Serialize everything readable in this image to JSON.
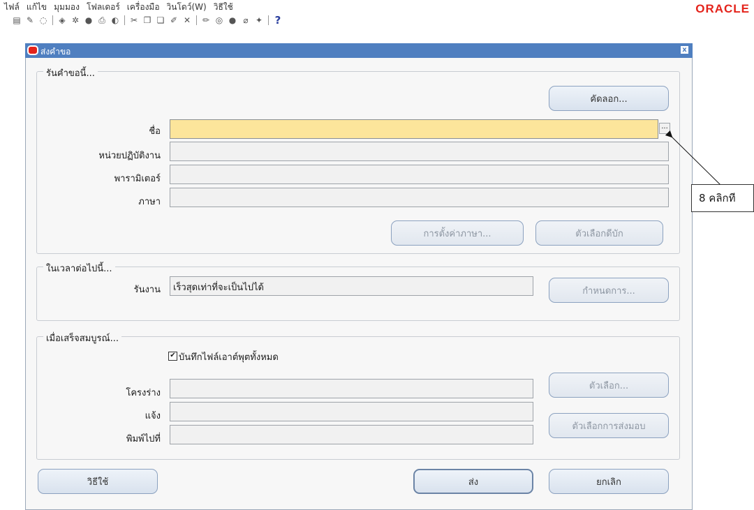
{
  "menubar": [
    "ไฟล์",
    "แก้ไข",
    "มุมมอง",
    "โฟลเดอร์",
    "เครื่องมือ",
    "วินโดว์(W)",
    "วิธีใช้"
  ],
  "brand": "ORACLE",
  "toolbar_help": "?",
  "window": {
    "title": "ส่งคำขอ",
    "close": "x"
  },
  "request_group": {
    "label": "รันคำขอนี้...",
    "copy_button": "คัดลอก...",
    "fields": [
      {
        "label": "ชื่อ",
        "value": ""
      },
      {
        "label": "หน่วยปฏิบัติงาน",
        "value": ""
      },
      {
        "label": "พารามิเตอร์",
        "value": ""
      },
      {
        "label": "ภาษา",
        "value": ""
      }
    ],
    "lov_button": "...",
    "language_settings_button": "การตั้งค่าภาษา...",
    "debug_options_button": "ตัวเลือกดีบัก"
  },
  "schedule_group": {
    "label": "ในเวลาต่อไปนี้...",
    "run_label": "รันงาน",
    "run_value": "เร็วสุดเท่าที่จะเป็นไปได้",
    "schedule_button": "กำหนดการ..."
  },
  "completion_group": {
    "label": "เมื่อเสร็จสมบูรณ์...",
    "save_output_checked": true,
    "save_output_label": "บันทึกไฟล์เอาต์พุตทั้งหมด",
    "layout_label": "โครงร่าง",
    "notify_label": "แจ้ง",
    "print_label": "พิมพ์ไปที่",
    "layout_value": "",
    "notify_value": "",
    "print_value": "",
    "options_button": "ตัวเลือก...",
    "delivery_options_button": "ตัวเลือกการส่งมอบ"
  },
  "footer": {
    "help_button": "วิธีใช้",
    "submit_button": "ส่ง",
    "cancel_button": "ยกเลิก"
  },
  "annotation": {
    "text": "8 คลิกที"
  },
  "colors": {
    "titlebar": "#4f7fc0",
    "required_field": "#fce59b",
    "brand": "#e4231b"
  }
}
